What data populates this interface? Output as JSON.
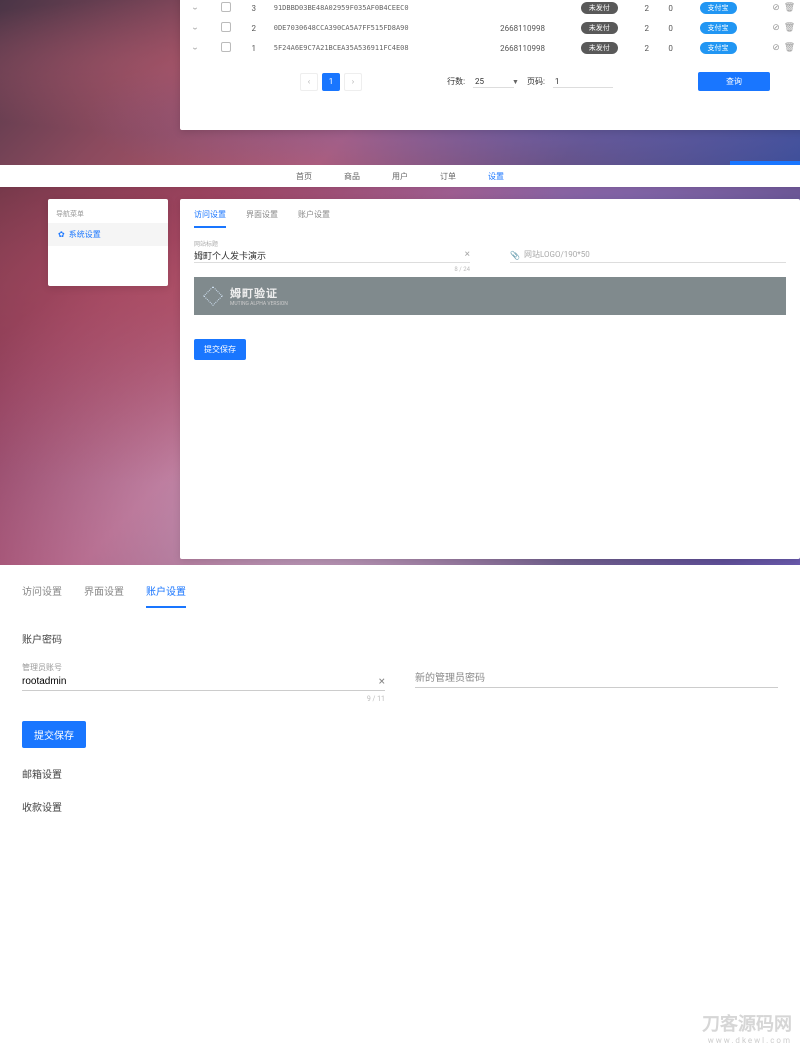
{
  "table": {
    "rows": [
      {
        "idx": "3",
        "code": "91DBBD03BE48A02959F035AF0B4CEEC0",
        "phone": "",
        "badge": "未发付",
        "n1": "2",
        "n2": "0",
        "link": "支付宝"
      },
      {
        "idx": "2",
        "code": "0DE7030648CCA390CA5A7FF515FD8A90",
        "phone": "2668110998",
        "badge": "未发付",
        "n1": "2",
        "n2": "0",
        "link": "支付宝"
      },
      {
        "idx": "1",
        "code": "5F24A6E9C7A21BCEA35A536911FC4E08",
        "phone": "2668110998",
        "badge": "未发付",
        "n1": "2",
        "n2": "0",
        "link": "支付宝"
      }
    ],
    "per_page_label": "行数:",
    "per_page_value": "25",
    "page_label": "页码:",
    "page_value": "1",
    "refresh": "查询",
    "current_page": "1"
  },
  "topnav": {
    "items": [
      "首页",
      "商品",
      "用户",
      "订单",
      "设置"
    ],
    "active": 4
  },
  "sidebar": {
    "heading": "导航菜单",
    "items": [
      {
        "label": "系统设置"
      }
    ]
  },
  "settings_tabs": [
    "访问设置",
    "界面设置",
    "账户设置"
  ],
  "settings": {
    "sitename_label": "网站标题",
    "sitename_value": "姆町个人发卡演示",
    "sitename_counter": "8 / 24",
    "logo_label": "网站LOGO/190*50",
    "banner_title": "姆町验证",
    "banner_sub": "MUTING ALPHA VERSION",
    "submit": "提交保存"
  },
  "account": {
    "tabs": [
      "访问设置",
      "界面设置",
      "账户设置"
    ],
    "active": 2,
    "pwd_section": "账户密码",
    "admin_label": "管理员账号",
    "admin_value": "rootadmin",
    "admin_counter": "9 / 11",
    "newpw_placeholder": "新的管理员密码",
    "submit": "提交保存",
    "mail_section": "邮箱设置",
    "pay_section": "收款设置"
  },
  "watermark": {
    "cn": "刀客源码网",
    "url": "www.dkewl.com"
  }
}
